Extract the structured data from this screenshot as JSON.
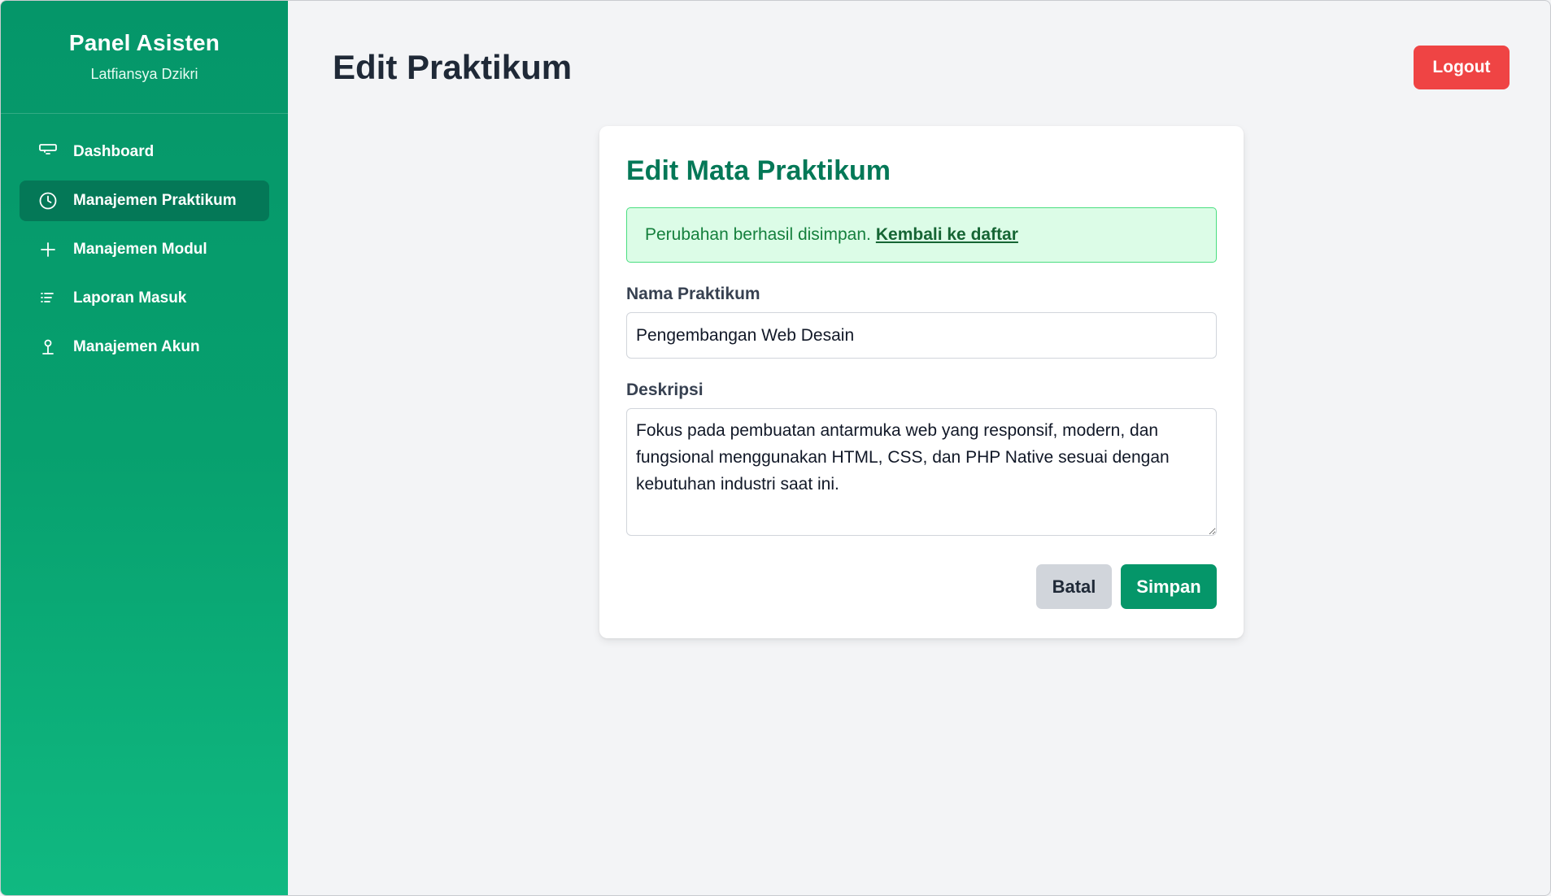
{
  "sidebar": {
    "brand_title": "Panel Asisten",
    "user_name": "Latfiansya Dzikri",
    "items": [
      {
        "label": "Dashboard",
        "icon": "monitor-icon",
        "active": false
      },
      {
        "label": "Manajemen Praktikum",
        "icon": "clock-icon",
        "active": true
      },
      {
        "label": "Manajemen Modul",
        "icon": "plus-icon",
        "active": false
      },
      {
        "label": "Laporan Masuk",
        "icon": "list-icon",
        "active": false
      },
      {
        "label": "Manajemen Akun",
        "icon": "user-icon",
        "active": false
      }
    ]
  },
  "header": {
    "title": "Edit Praktikum",
    "logout_label": "Logout"
  },
  "form": {
    "card_title": "Edit Mata Praktikum",
    "alert_text": "Perubahan berhasil disimpan.",
    "alert_link": "Kembali ke daftar",
    "name_label": "Nama Praktikum",
    "name_value": "Pengembangan Web Desain",
    "desc_label": "Deskripsi",
    "desc_value": "Fokus pada pembuatan antarmuka web yang responsif, modern, dan fungsional menggunakan HTML, CSS, dan PHP Native sesuai dengan kebutuhan industri saat ini.",
    "cancel_label": "Batal",
    "save_label": "Simpan"
  },
  "colors": {
    "sidebar_top": "#059669",
    "sidebar_bottom": "#10b981",
    "active_item": "#047857",
    "logout": "#ef4444",
    "save": "#059669",
    "alert_bg": "#dcfce7"
  }
}
